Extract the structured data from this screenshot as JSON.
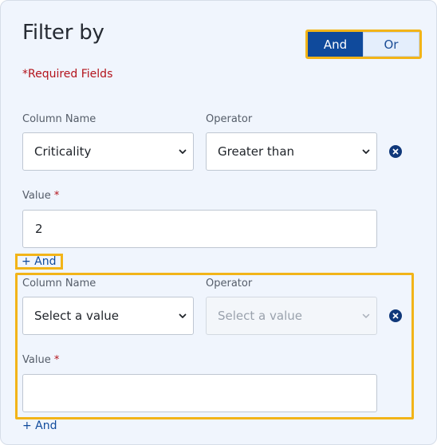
{
  "header": {
    "title": "Filter by",
    "required_note": "*Required Fields"
  },
  "logic_toggle": {
    "options": [
      "And",
      "Or"
    ],
    "selected": "And"
  },
  "filters": [
    {
      "column_label": "Column Name",
      "operator_label": "Operator",
      "value_label": "Value",
      "value_required_mark": "*",
      "column_value": "Criticality",
      "operator_value": "Greater than",
      "value": "2",
      "add_link": "+ And"
    },
    {
      "column_label": "Column Name",
      "operator_label": "Operator",
      "value_label": "Value",
      "value_required_mark": "*",
      "column_value": "Select a value",
      "operator_value": "Select a value",
      "value": "",
      "add_link": "+ And"
    }
  ],
  "colors": {
    "accent": "#0f4a9c",
    "highlight": "#f2b418",
    "required": "#b3131b"
  }
}
